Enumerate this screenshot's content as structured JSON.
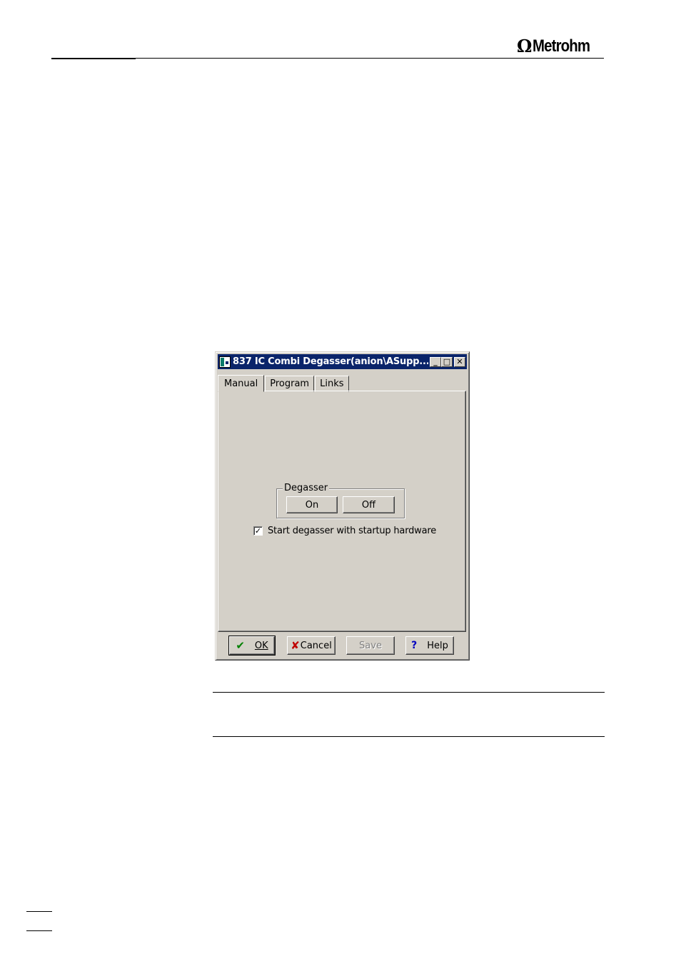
{
  "header": {
    "logo_omega": "Ω",
    "logo_text": "Metrohm"
  },
  "dialog": {
    "title": "837 IC Combi Degasser(anion\\ASupp...",
    "title_buttons": {
      "minimize": "_",
      "maximize": "□",
      "close": "✕"
    },
    "tabs": [
      {
        "label": "Manual",
        "active": true
      },
      {
        "label": "Program",
        "active": false
      },
      {
        "label": "Links",
        "active": false
      }
    ],
    "degasser_group": {
      "label": "Degasser",
      "on_label": "On",
      "off_label": "Off"
    },
    "startup_checkbox": {
      "label": "Start degasser with startup hardware",
      "checked": true,
      "mark": "✓"
    },
    "buttons": {
      "ok_label": "OK",
      "cancel_label": "Cancel",
      "save_label": "Save",
      "help_label": "Help"
    },
    "icons": {
      "ok": "✔",
      "cancel": "✘",
      "help": "?"
    }
  }
}
